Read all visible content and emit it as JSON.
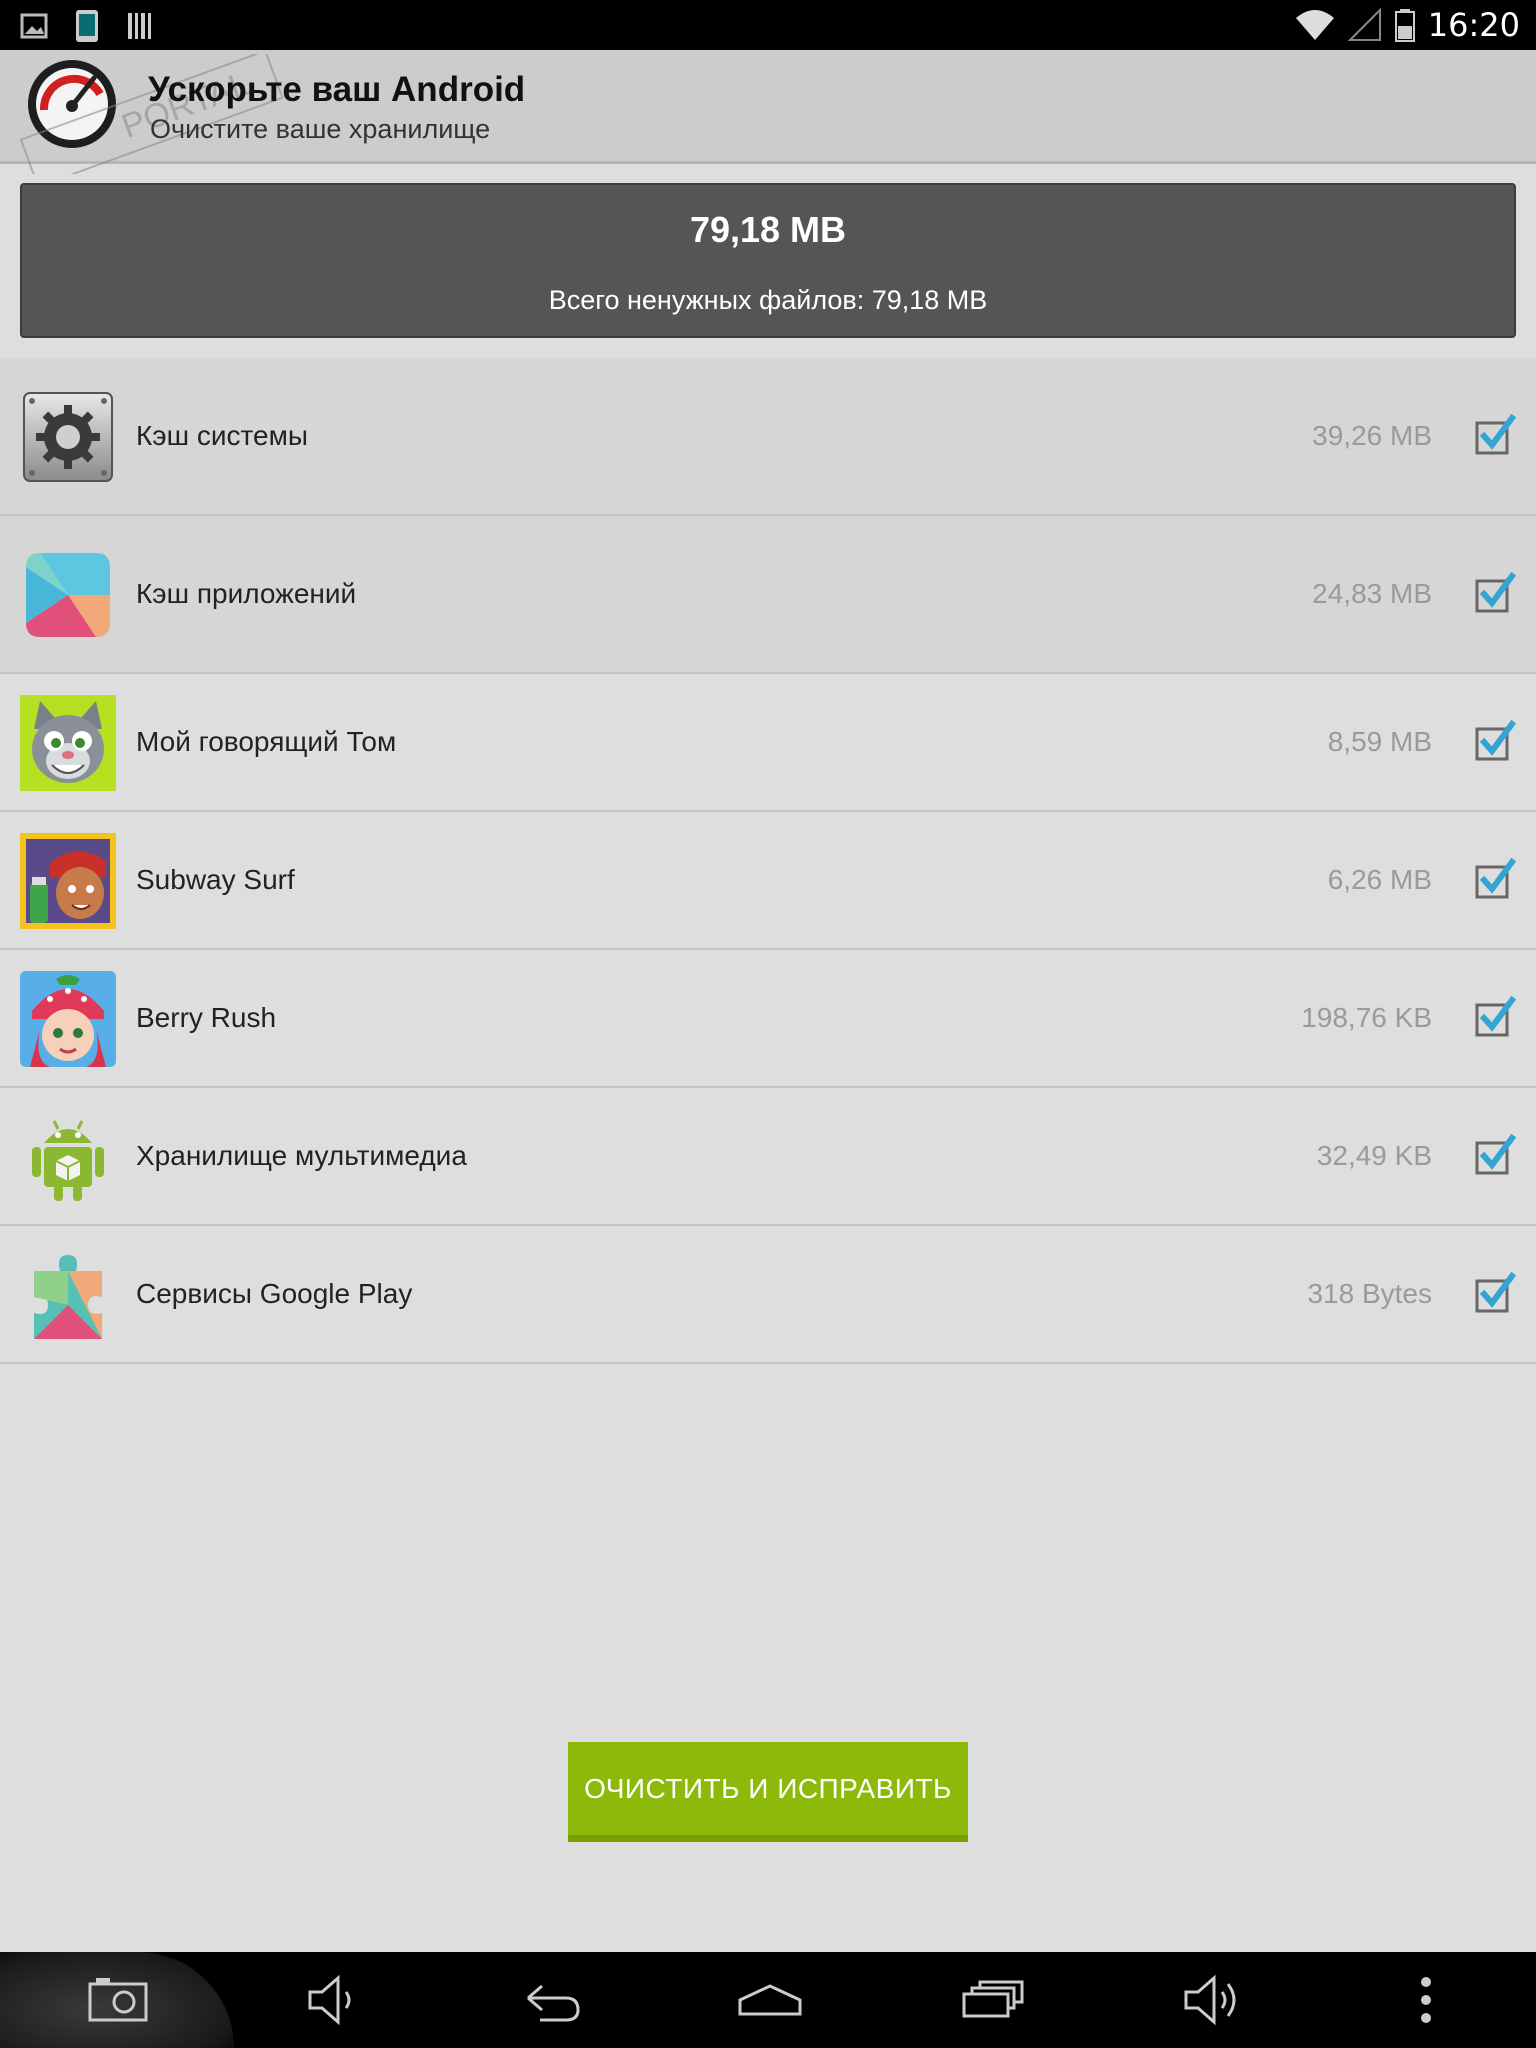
{
  "status_bar": {
    "time": "16:20",
    "left_icons": [
      "image-icon",
      "phone-icon",
      "barcode-icon"
    ],
    "right_icons": [
      "wifi-icon",
      "signal-icon",
      "battery-icon"
    ]
  },
  "header": {
    "title": "Ускорьте ваш Android",
    "subtitle": "Очистите ваше хранилище",
    "watermark_text": "PORTAL"
  },
  "summary": {
    "total": "79,18 MB",
    "label": "Всего ненужных файлов: 79,18 MB"
  },
  "items": [
    {
      "name": "Кэш системы",
      "size": "39,26 MB",
      "checked": true,
      "icon": "settings-gear-icon"
    },
    {
      "name": "Кэш приложений",
      "size": "24,83 MB",
      "checked": true,
      "icon": "play-store-icon"
    },
    {
      "name": "Мой говорящий Том",
      "size": "8,59 MB",
      "checked": true,
      "icon": "talking-tom-icon"
    },
    {
      "name": "Subway Surf",
      "size": "6,26 MB",
      "checked": true,
      "icon": "subway-surf-icon"
    },
    {
      "name": "Berry Rush",
      "size": "198,76 KB",
      "checked": true,
      "icon": "berry-rush-icon"
    },
    {
      "name": "Хранилище мультимедиа",
      "size": "32,49 KB",
      "checked": true,
      "icon": "android-robot-icon"
    },
    {
      "name": "Сервисы Google Play",
      "size": "318 Bytes",
      "checked": true,
      "icon": "google-play-services-icon"
    }
  ],
  "action": {
    "clean_label": "ОЧИСТИТЬ И ИСПРАВИТЬ"
  },
  "nav_bar": {
    "buttons": [
      "screenshot-icon",
      "volume-down-icon",
      "back-icon",
      "home-icon",
      "recents-icon",
      "volume-up-icon",
      "menu-icon"
    ]
  },
  "colors": {
    "accent_green": "#8dba0a",
    "checkbox_blue": "#33a4d4",
    "summary_bg": "#555556"
  }
}
